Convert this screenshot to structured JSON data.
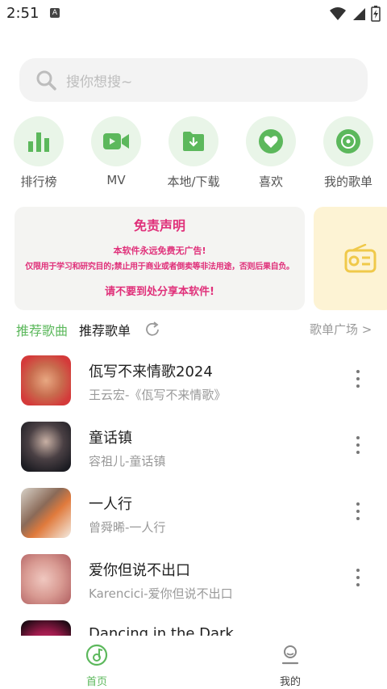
{
  "status_bar": {
    "time": "2:51",
    "notification": "A"
  },
  "search": {
    "placeholder": "搜你想搜~"
  },
  "quick_actions": [
    {
      "label": "排行榜",
      "icon": "bar-chart-icon"
    },
    {
      "label": "MV",
      "icon": "video-camera-icon"
    },
    {
      "label": "本地/下载",
      "icon": "folder-download-icon"
    },
    {
      "label": "喜欢",
      "icon": "heart-icon"
    },
    {
      "label": "我的歌单",
      "icon": "disc-icon"
    }
  ],
  "banner": {
    "title": "免责声明",
    "line1": "本软件永远免费无广告!",
    "line2": "仅限用于学习和研究目的;禁止用于商业或者倒卖等非法用途，否则后果自负。",
    "line3": "请不要到处分享本软件!"
  },
  "tabs": {
    "songs": "推荐歌曲",
    "playlists": "推荐歌单",
    "more": "歌单广场 >"
  },
  "songs": [
    {
      "title": "佤写不来情歌2024",
      "subtitle": "王云宏-《佤写不来情歌》"
    },
    {
      "title": "童话镇",
      "subtitle": "容祖儿-童话镇"
    },
    {
      "title": "一人行",
      "subtitle": "曾舜晞-一人行"
    },
    {
      "title": "爱你但说不出口",
      "subtitle": "Karencici-爱你但说不出口"
    },
    {
      "title": "Dancing in the Dark",
      "subtitle": ""
    }
  ],
  "bottom_nav": {
    "home": "首页",
    "mine": "我的"
  },
  "colors": {
    "accent": "#5cb85c",
    "banner_text": "#e0307a",
    "icon_bg": "#e9f5e8"
  }
}
